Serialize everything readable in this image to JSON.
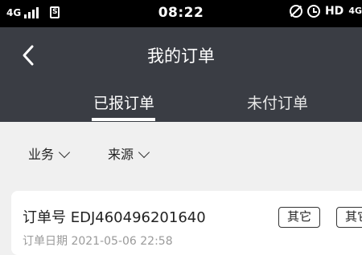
{
  "status_bar": {
    "network_left": "4G",
    "sim_label": "S",
    "time": "08:22",
    "hd_label": "HD",
    "network_right": "4G"
  },
  "header": {
    "title": "我的订单",
    "back_icon": "chevron-left-icon",
    "tabs": [
      {
        "label": "已报订单",
        "active": true
      },
      {
        "label": "未付订单",
        "active": false
      }
    ]
  },
  "filters": [
    {
      "label": "业务",
      "icon": "chevron-down-icon"
    },
    {
      "label": "来源",
      "icon": "chevron-down-icon"
    }
  ],
  "orders": [
    {
      "order_no": "订单号 EDJ460496201640",
      "date": "订单日期 2021-05-06 22:58",
      "buttons": [
        "其它",
        "其它"
      ]
    }
  ]
}
